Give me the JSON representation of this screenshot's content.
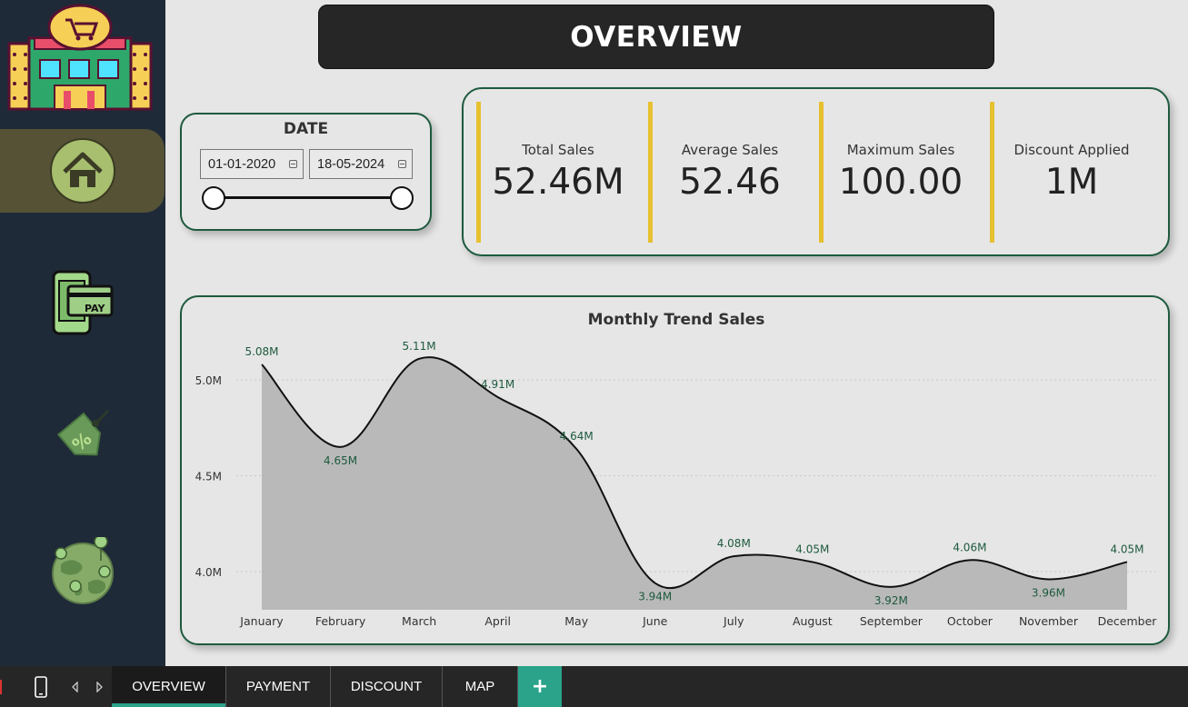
{
  "header": {
    "title": "OVERVIEW"
  },
  "date_filter": {
    "title": "DATE",
    "start": "01-01-2020",
    "end": "18-05-2024"
  },
  "kpis": [
    {
      "label": "Total Sales",
      "value": "52.46M"
    },
    {
      "label": "Average Sales",
      "value": "52.46"
    },
    {
      "label": "Maximum Sales",
      "value": "100.00"
    },
    {
      "label": "Discount Applied",
      "value": "1M"
    }
  ],
  "sidebar": {
    "items": [
      {
        "name": "home",
        "icon": "home-icon",
        "active": true
      },
      {
        "name": "payment",
        "icon": "payment-icon",
        "badge": "PAY",
        "active": false
      },
      {
        "name": "discount",
        "icon": "discount-tag-icon",
        "active": false
      },
      {
        "name": "map",
        "icon": "globe-map-icon",
        "active": false
      }
    ]
  },
  "tabs": {
    "items": [
      "OVERVIEW",
      "PAYMENT",
      "DISCOUNT",
      "MAP"
    ],
    "active": "OVERVIEW",
    "add_label": "+"
  },
  "colors": {
    "sidebar_bg": "#1f2a38",
    "accent_green": "#1e5a3e",
    "kpi_bar": "#e6c02f",
    "tab_accent": "#2aa38a",
    "area_fill": "#b9b9b9"
  },
  "chart_data": {
    "type": "area",
    "title": "Monthly Trend Sales",
    "categories": [
      "January",
      "February",
      "March",
      "April",
      "May",
      "June",
      "July",
      "August",
      "September",
      "October",
      "November",
      "December"
    ],
    "values": [
      5.08,
      4.65,
      5.11,
      4.91,
      4.64,
      3.94,
      4.08,
      4.05,
      3.92,
      4.06,
      3.96,
      4.05
    ],
    "value_labels": [
      "5.08M",
      "4.65M",
      "5.11M",
      "4.91M",
      "4.64M",
      "3.94M",
      "4.08M",
      "4.05M",
      "3.92M",
      "4.06M",
      "3.96M",
      "4.05M"
    ],
    "yticks": [
      4.0,
      4.5,
      5.0
    ],
    "ytick_labels": [
      "4.0M",
      "4.5M",
      "5.0M"
    ],
    "ylim": [
      3.8,
      5.2
    ],
    "grid": true,
    "xlabel": "",
    "ylabel": ""
  }
}
